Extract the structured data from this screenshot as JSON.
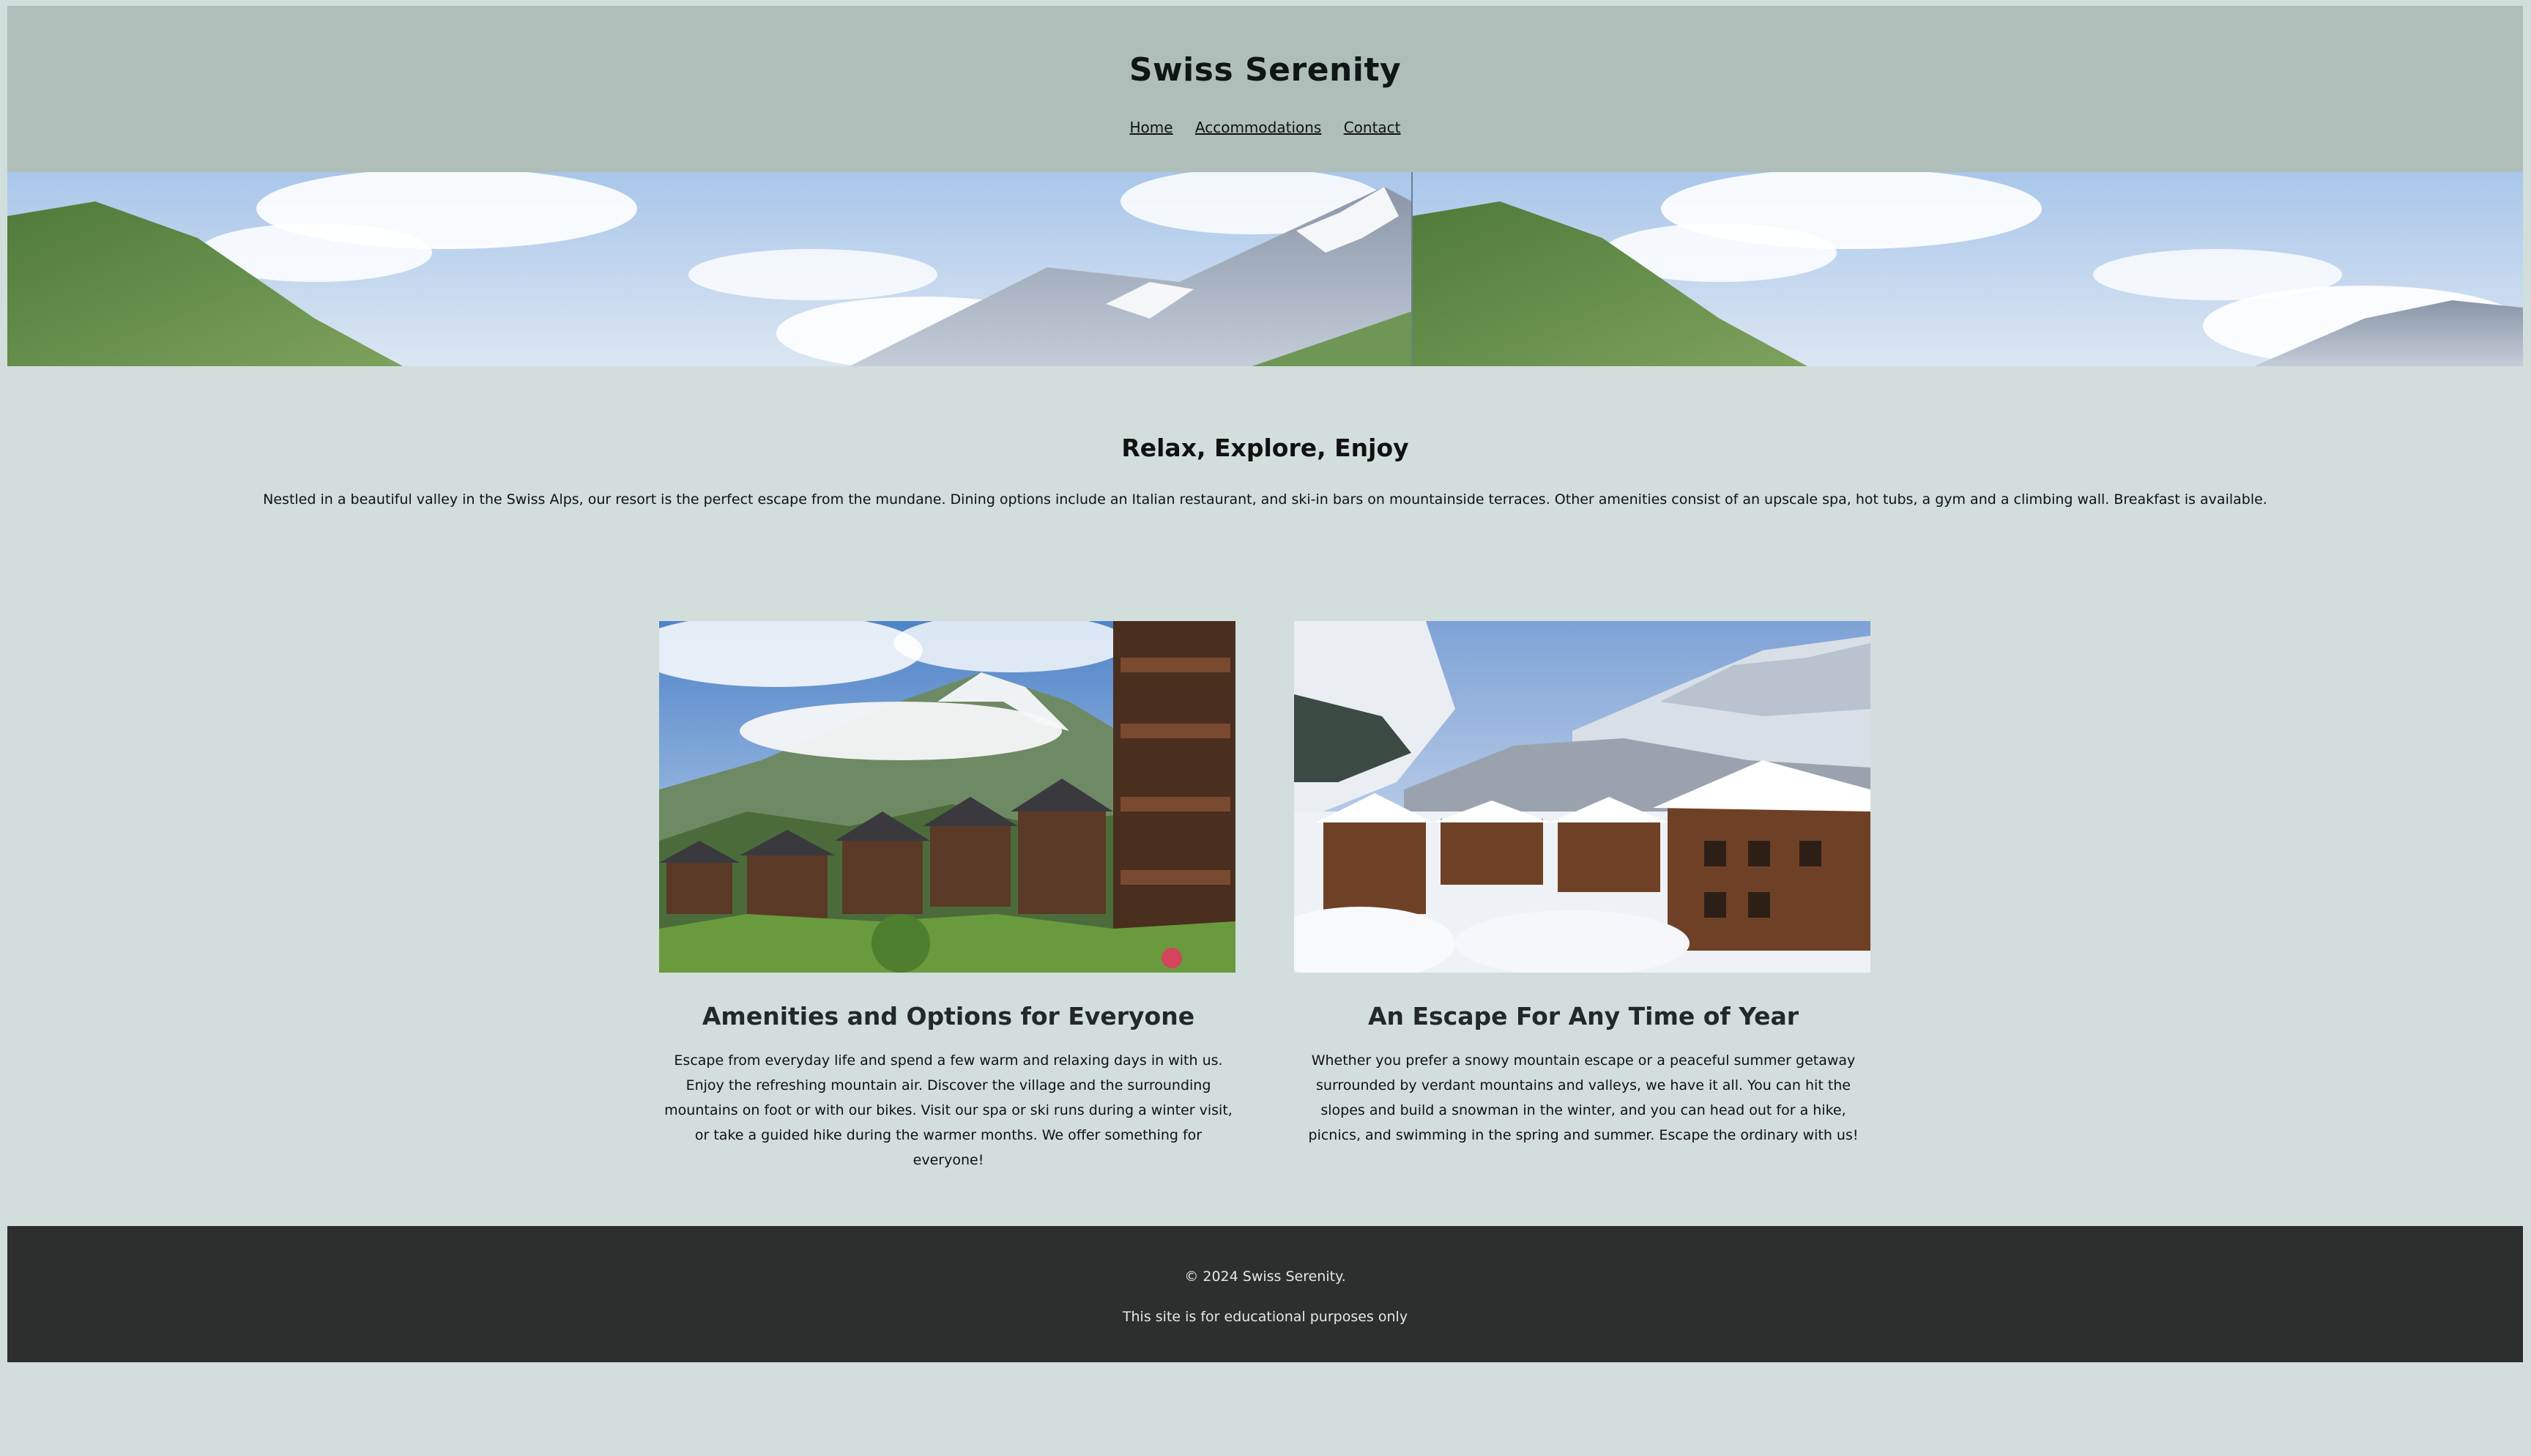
{
  "header": {
    "title": "Swiss Serenity",
    "nav": [
      {
        "label": "Home"
      },
      {
        "label": "Accommodations"
      },
      {
        "label": "Contact"
      }
    ]
  },
  "intro": {
    "heading": "Relax, Explore, Enjoy",
    "text": "Nestled in a beautiful valley in the Swiss Alps, our resort is the perfect escape from the mundane. Dining options include an Italian restaurant, and ski-in bars on mountainside terraces. Other amenities consist of an upscale spa, hot tubs, a gym and a climbing wall. Breakfast is available."
  },
  "cards": [
    {
      "heading": "Amenities and Options for Everyone",
      "text": "Escape from everyday life and spend a few warm and relaxing days in with us. Enjoy the refreshing mountain air. Discover the village and the surrounding mountains on foot or with our bikes. Visit our spa or ski runs during a winter visit, or take a guided hike during the warmer months. We offer something for everyone!"
    },
    {
      "heading": "An Escape For Any Time of Year",
      "text": "Whether you prefer a snowy mountain escape or a peaceful summer getaway surrounded by verdant mountains and valleys, we have it all. You can hit the slopes and build a snowman in the winter, and you can head out for a hike, picnics, and swimming in the spring and summer. Escape the ordinary with us!"
    }
  ],
  "footer": {
    "copyright": "© 2024 Swiss Serenity.",
    "note": "This site is for educational purposes only"
  },
  "colors": {
    "page_background": "#d1dedc",
    "header_background": "#afbeb9",
    "footer_background": "#2d2f2f"
  }
}
